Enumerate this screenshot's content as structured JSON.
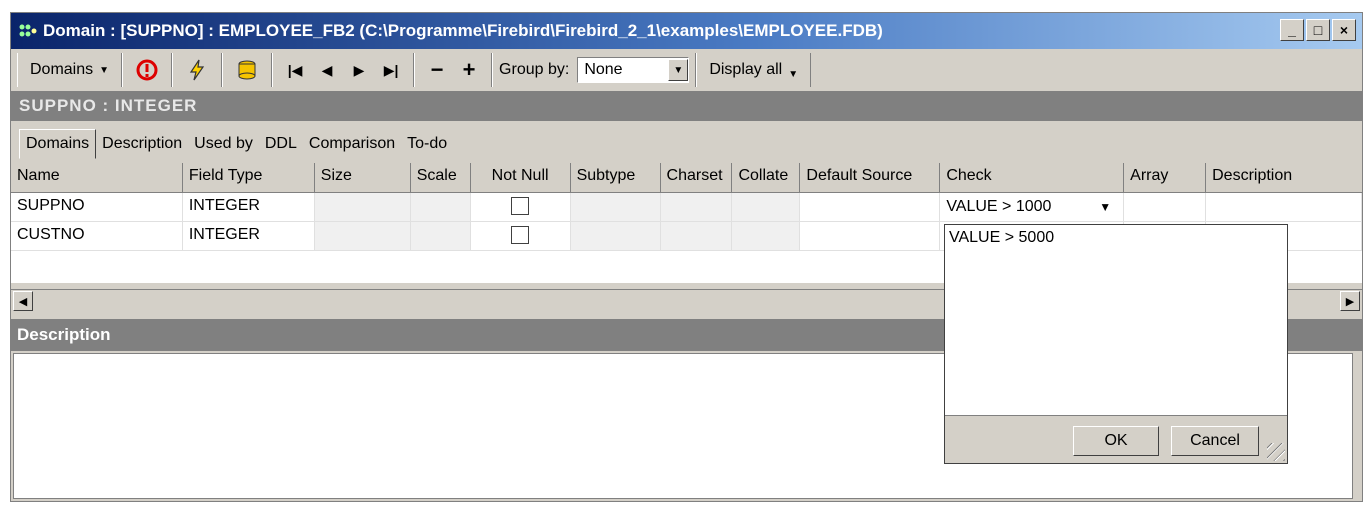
{
  "window": {
    "title": "Domain : [SUPPNO] : EMPLOYEE_FB2 (C:\\Programme\\Firebird\\Firebird_2_1\\examples\\EMPLOYEE.FDB)",
    "minimize": "_",
    "maximize": "□",
    "close": "×"
  },
  "toolbar": {
    "domains_label": "Domains",
    "group_by_label": "Group by:",
    "group_by_value": "None",
    "display_all_label": "Display all"
  },
  "header": {
    "title": "SUPPNO : INTEGER"
  },
  "tabs": [
    {
      "label": "Domains"
    },
    {
      "label": "Description"
    },
    {
      "label": "Used by"
    },
    {
      "label": "DDL"
    },
    {
      "label": "Comparison"
    },
    {
      "label": "To-do"
    }
  ],
  "grid": {
    "columns": [
      "Name",
      "Field Type",
      "Size",
      "Scale",
      "Not Null",
      "Subtype",
      "Charset",
      "Collate",
      "Default Source",
      "Check",
      "Array",
      "Description"
    ],
    "rows": [
      {
        "name": "SUPPNO",
        "type": "INTEGER",
        "check": "VALUE > 1000"
      },
      {
        "name": "CUSTNO",
        "type": "INTEGER",
        "check": ""
      }
    ]
  },
  "description": {
    "title": "Description"
  },
  "popup": {
    "text": "VALUE > 5000",
    "ok": "OK",
    "cancel": "Cancel"
  }
}
